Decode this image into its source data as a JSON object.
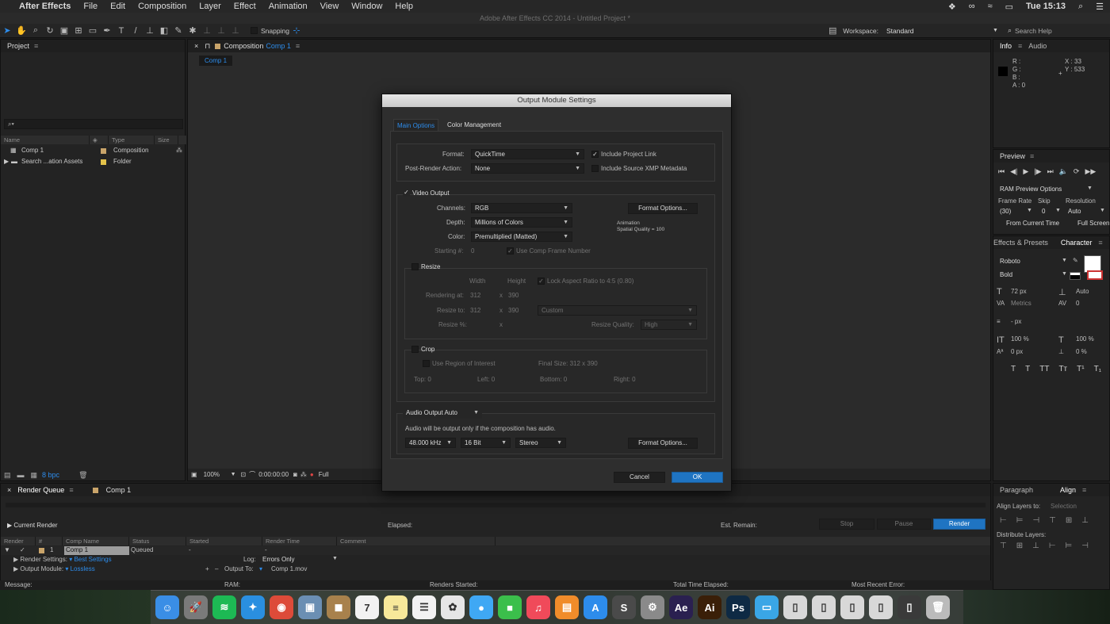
{
  "menubar": {
    "app": "After Effects",
    "items": [
      "File",
      "Edit",
      "Composition",
      "Layer",
      "Effect",
      "Animation",
      "View",
      "Window",
      "Help"
    ],
    "clock": "Tue 15:13"
  },
  "window_title": "Adobe After Effects CC 2014 - Untitled Project *",
  "toolbar": {
    "snapping": "Snapping",
    "workspace_label": "Workspace:",
    "workspace_value": "Standard",
    "search_placeholder": "Search Help"
  },
  "project": {
    "tab": "Project",
    "search_placeholder": "",
    "columns": [
      "Name",
      "Type",
      "Size"
    ],
    "items": [
      {
        "name": "Comp 1",
        "type": "Composition",
        "color": "#c9a46a"
      },
      {
        "name": "Search ...ation Assets",
        "type": "Folder",
        "color": "#e3c24a"
      }
    ],
    "bpc": "8 bpc"
  },
  "composition": {
    "tab_prefix": "Composition",
    "tab_name": "Comp 1",
    "subtab": "Comp 1",
    "zoom": "100%",
    "timecode": "0:00:00:00",
    "resolution": "Full"
  },
  "info": {
    "tabs": [
      "Info",
      "Audio"
    ],
    "r": "R :",
    "g": "G :",
    "b": "B :",
    "a": "A : 0",
    "x": "X : 33",
    "y": "Y : 533"
  },
  "preview": {
    "tab": "Preview",
    "ram": "RAM Preview Options",
    "frame_rate_label": "Frame Rate",
    "skip_label": "Skip",
    "resolution_label": "Resolution",
    "frame_rate": "(30)",
    "skip": "0",
    "resolution": "Auto",
    "from_current": "From Current Time",
    "full_screen": "Full Screen"
  },
  "character": {
    "tabs": [
      "Effects & Presets",
      "Character"
    ],
    "font": "Roboto",
    "style": "Bold",
    "size": "72 px",
    "leading": "Auto",
    "kerning": "Metrics",
    "tracking": "0",
    "stroke": "- px",
    "vscale": "100 %",
    "hscale": "100 %",
    "baseline": "0 px",
    "tsume": "0 %",
    "styles": [
      "T",
      "T",
      "TT",
      "Tт",
      "T¹",
      "T₁"
    ]
  },
  "paragraph": {
    "tabs": [
      "Paragraph",
      "Align"
    ],
    "align_to_label": "Align Layers to:",
    "align_to_value": "Selection",
    "distribute_label": "Distribute Layers:"
  },
  "render_queue": {
    "tab": "Render Queue",
    "comp_tab": "Comp 1",
    "current_render": "Current Render",
    "elapsed": "Elapsed:",
    "remain": "Est. Remain:",
    "stop": "Stop",
    "pause": "Pause",
    "render": "Render",
    "columns": [
      "Render",
      "#",
      "Comp Name",
      "Status",
      "Started",
      "Render Time",
      "Comment"
    ],
    "row": {
      "num": "1",
      "comp": "Comp 1",
      "status": "Queued",
      "started": "-",
      "rtime": "-"
    },
    "render_settings_label": "Render Settings:",
    "render_settings_value": "Best Settings",
    "log_label": "Log:",
    "log_value": "Errors Only",
    "output_module_label": "Output Module:",
    "output_module_value": "Lossless",
    "output_to_label": "Output To:",
    "output_to_value": "Comp 1.mov"
  },
  "status_bar": {
    "message": "Message:",
    "ram": "RAM:",
    "renders_started": "Renders Started:",
    "total_elapsed": "Total Time Elapsed:",
    "recent_error": "Most Recent Error:"
  },
  "dialog": {
    "title": "Output Module Settings",
    "tabs": [
      "Main Options",
      "Color Management"
    ],
    "format_label": "Format:",
    "format_value": "QuickTime",
    "include_project_link": "Include Project Link",
    "post_render_label": "Post-Render Action:",
    "post_render_value": "None",
    "include_xmp": "Include Source XMP Metadata",
    "video_output": "Video Output",
    "channels_label": "Channels:",
    "channels_value": "RGB",
    "format_options": "Format Options...",
    "depth_label": "Depth:",
    "depth_value": "Millions of Colors",
    "codec_line1": "Animation",
    "codec_line2": "Spatial Quality = 100",
    "color_label": "Color:",
    "color_value": "Premultiplied (Matted)",
    "starting_label": "Starting #:",
    "starting_value": "0",
    "use_comp_frame": "Use Comp Frame Number",
    "resize": "Resize",
    "width": "Width",
    "height": "Height",
    "lock_aspect": "Lock Aspect Ratio to 4:5 (0.80)",
    "rendering_at_label": "Rendering at:",
    "rendering_w": "312",
    "rendering_h": "390",
    "resize_to_label": "Resize to:",
    "resize_w": "312",
    "resize_h": "390",
    "resize_preset": "Custom",
    "resize_pct_label": "Resize %:",
    "x": "x",
    "resize_quality_label": "Resize Quality:",
    "resize_quality_value": "High",
    "crop": "Crop",
    "use_roi": "Use Region of Interest",
    "final_size": "Final Size: 312 x 390",
    "top": "Top:  0",
    "left": "Left:  0",
    "bottom": "Bottom:  0",
    "right": "Right:  0",
    "audio_output": "Audio Output Auto",
    "audio_note": "Audio will be output only if the composition has audio.",
    "sample_rate": "48.000 kHz",
    "bit_depth": "16 Bit",
    "channels_audio": "Stereo",
    "audio_format_options": "Format Options...",
    "cancel": "Cancel",
    "ok": "OK"
  },
  "dock": {
    "items": [
      {
        "name": "finder",
        "glyph": "☺",
        "color": "#3a8ee6"
      },
      {
        "name": "launchpad",
        "glyph": "🚀",
        "color": "#7a7a7a"
      },
      {
        "name": "spotify",
        "glyph": "≋",
        "color": "#1db954"
      },
      {
        "name": "safari",
        "glyph": "✦",
        "color": "#2a8fe0"
      },
      {
        "name": "chrome",
        "glyph": "◉",
        "color": "#dd4b39"
      },
      {
        "name": "preview",
        "glyph": "▣",
        "color": "#6b8fb3"
      },
      {
        "name": "contacts",
        "glyph": "◼",
        "color": "#a8814c"
      },
      {
        "name": "calendar",
        "glyph": "7",
        "color": "#f2f2f2"
      },
      {
        "name": "notes",
        "glyph": "≡",
        "color": "#f7e89a"
      },
      {
        "name": "reminders",
        "glyph": "☰",
        "color": "#f2f2f2"
      },
      {
        "name": "photos",
        "glyph": "✿",
        "color": "#e6e6e6"
      },
      {
        "name": "messages",
        "glyph": "●",
        "color": "#3fa8f4"
      },
      {
        "name": "facetime",
        "glyph": "■",
        "color": "#3bbf4b"
      },
      {
        "name": "itunes",
        "glyph": "♫",
        "color": "#f04a5a"
      },
      {
        "name": "ibooks",
        "glyph": "▤",
        "color": "#f08c2a"
      },
      {
        "name": "appstore",
        "glyph": "A",
        "color": "#2d8ceb"
      },
      {
        "name": "sublime",
        "glyph": "S",
        "color": "#4a4a4a"
      },
      {
        "name": "preferences",
        "glyph": "⚙",
        "color": "#8a8a8a"
      },
      {
        "name": "after-effects",
        "glyph": "Ae",
        "color": "#2a2050"
      },
      {
        "name": "illustrator",
        "glyph": "Ai",
        "color": "#3a1f08"
      },
      {
        "name": "photoshop",
        "glyph": "Ps",
        "color": "#0e2a44"
      },
      {
        "name": "downloads",
        "glyph": "▭",
        "color": "#3aa6e6"
      },
      {
        "name": "window-1",
        "glyph": "▯",
        "color": "#d8d8d8"
      },
      {
        "name": "window-2",
        "glyph": "▯",
        "color": "#d8d8d8"
      },
      {
        "name": "window-3",
        "glyph": "▯",
        "color": "#d8d8d8"
      },
      {
        "name": "window-4",
        "glyph": "▯",
        "color": "#d8d8d8"
      },
      {
        "name": "window-5",
        "glyph": "▯",
        "color": "#3a3a3a"
      },
      {
        "name": "trash",
        "glyph": "🗑",
        "color": "#bbbbbb"
      }
    ]
  }
}
